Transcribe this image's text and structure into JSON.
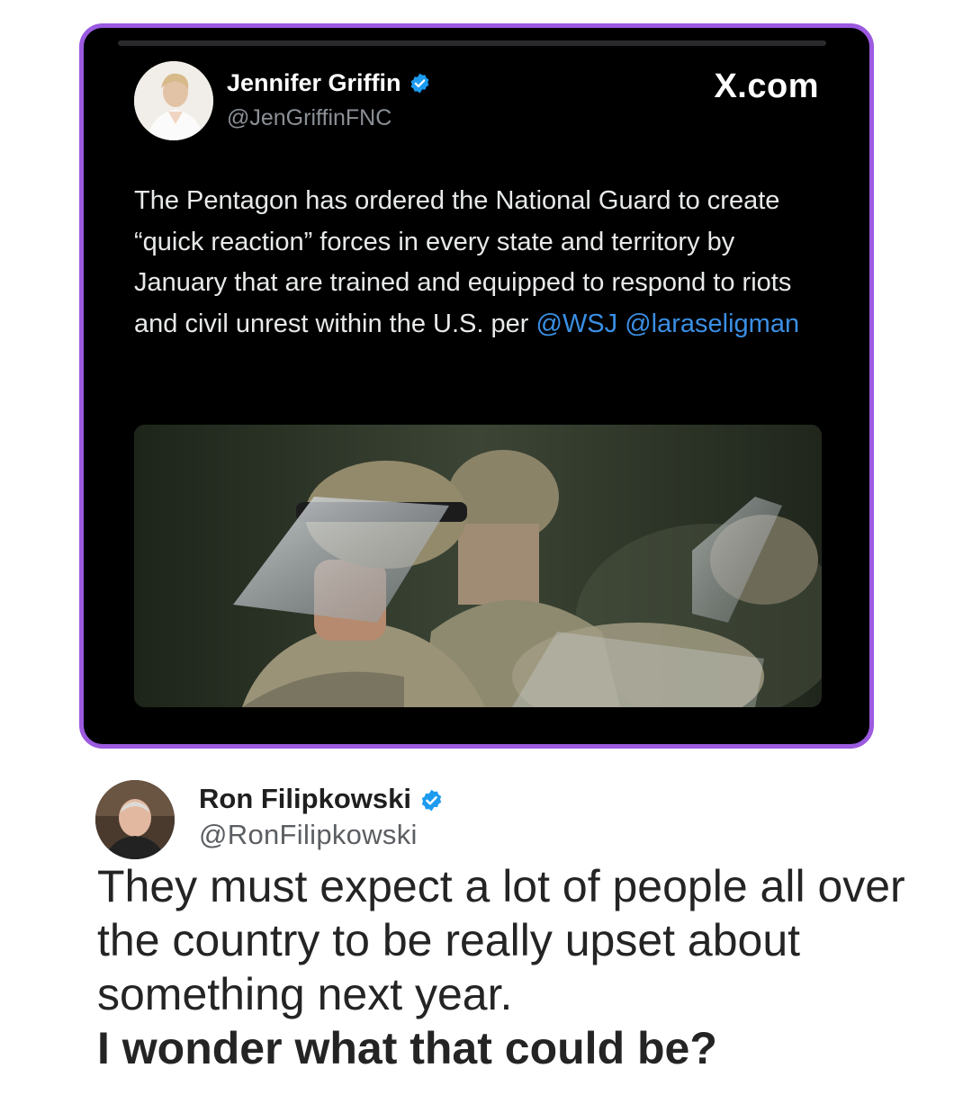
{
  "quoted_tweet": {
    "author_name": "Jennifer Griffin",
    "author_handle": "@JenGriffinFNC",
    "brand": "X.com",
    "body": "The Pentagon has ordered the National Guard to create “quick reaction” forces in every state and territory by January that are trained and equipped to respond to riots and civil unrest within the U.S. per",
    "mentions": [
      "@WSJ",
      "@laraseligman"
    ],
    "accent_color": "#9b5ae0",
    "link_color": "#3a8fe4"
  },
  "reply_tweet": {
    "author_name": "Ron Filipkowski",
    "author_handle": "@RonFilipkowski",
    "body": "They must expect a lot of people all over the country to be really upset about something next year.",
    "emphasis": "I wonder what that could be?"
  },
  "icons": {
    "verified": "verified-badge-icon",
    "verified_color": "#1d9bf0"
  }
}
